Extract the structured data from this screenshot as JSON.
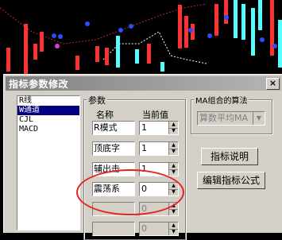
{
  "dialog": {
    "title": "指标参数修改",
    "close_label": "×"
  },
  "indicator_list": [
    {
      "label": "R线",
      "selected": false
    },
    {
      "label": "W通道",
      "selected": true
    },
    {
      "label": "CJL",
      "selected": false
    },
    {
      "label": "MACD",
      "selected": false
    }
  ],
  "params": {
    "group_label": "参数",
    "col_name": "名称",
    "col_value": "当前值",
    "rows": [
      {
        "name": "R模式",
        "value": "1",
        "enabled": true
      },
      {
        "name": "顶底字",
        "value": "1",
        "enabled": true
      },
      {
        "name": "辅出击",
        "value": "1",
        "enabled": true
      },
      {
        "name": "震荡系",
        "value": "0",
        "enabled": true
      },
      {
        "name": "",
        "value": "0",
        "enabled": false
      },
      {
        "name": "",
        "value": "0",
        "enabled": false
      }
    ]
  },
  "ma_group": {
    "label": "MA组合的算法",
    "selected": "算数平均MA"
  },
  "buttons": {
    "explain": "指标说明",
    "edit_formula": "编辑指标公式"
  },
  "colors": {
    "selection": "#000080",
    "annotation": "#e8231e",
    "candle_up": "#ff3232",
    "candle_down": "#54ffff",
    "ma_dot": "#2a4bff"
  }
}
